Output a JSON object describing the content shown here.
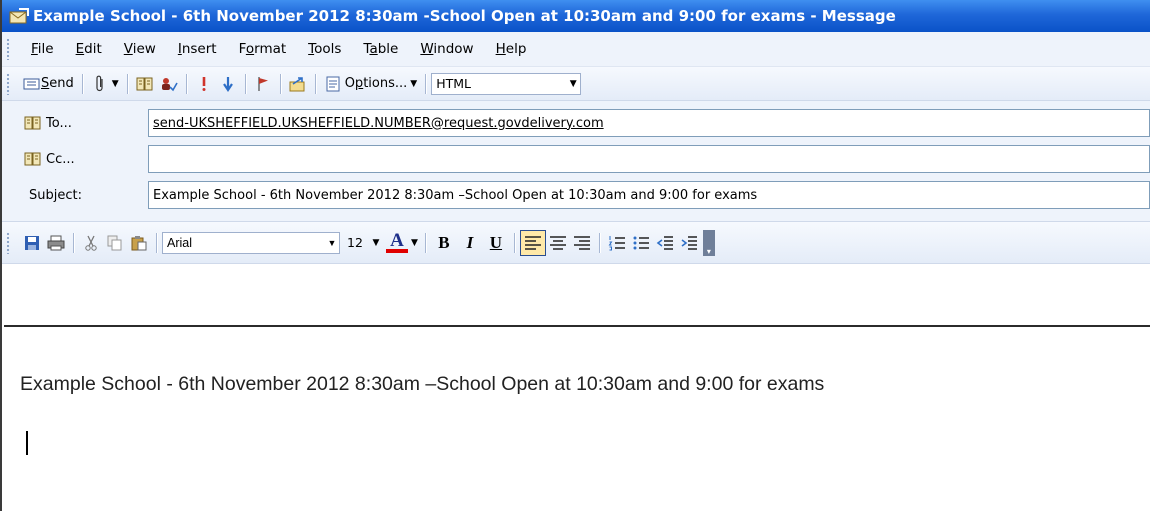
{
  "window": {
    "title": "Example School - 6th November 2012 8:30am -School Open at 10:30am and 9:00 for exams - Message"
  },
  "menu": [
    {
      "pre": "",
      "u": "F",
      "post": "ile"
    },
    {
      "pre": "",
      "u": "E",
      "post": "dit"
    },
    {
      "pre": "",
      "u": "V",
      "post": "iew"
    },
    {
      "pre": "",
      "u": "I",
      "post": "nsert"
    },
    {
      "pre": "F",
      "u": "o",
      "post": "rmat"
    },
    {
      "pre": "",
      "u": "T",
      "post": "ools"
    },
    {
      "pre": "T",
      "u": "a",
      "post": "ble"
    },
    {
      "pre": "",
      "u": "W",
      "post": "indow"
    },
    {
      "pre": "",
      "u": "H",
      "post": "elp"
    }
  ],
  "toolbar": {
    "send_label_pre": "",
    "send_label_u": "S",
    "send_label_post": "end",
    "options_label_pre": "O",
    "options_label_u": "p",
    "options_label_post": "tions...",
    "format_value": "HTML"
  },
  "address": {
    "to_label": "To...",
    "to_value": "send-UKSHEFFIELD.UKSHEFFIELD.NUMBER@request.govdelivery.com",
    "cc_label": "Cc...",
    "cc_value": "",
    "subject_label": "Subject:",
    "subject_value": "Example School - 6th November 2012 8:30am –School Open at 10:30am and 9:00 for exams"
  },
  "formatting": {
    "font_name": "Arial",
    "font_size": "12",
    "bold_glyph": "B",
    "italic_glyph": "I",
    "underline_glyph": "U",
    "font_color_glyph": "A"
  },
  "message": {
    "body_text": "Example School - 6th November 2012 8:30am –School Open at 10:30am and 9:00 for exams"
  },
  "colors": {
    "titlebar": "#0a52c8",
    "toolbar": "#e4ecf8",
    "font_color_underline": "#e00000"
  }
}
